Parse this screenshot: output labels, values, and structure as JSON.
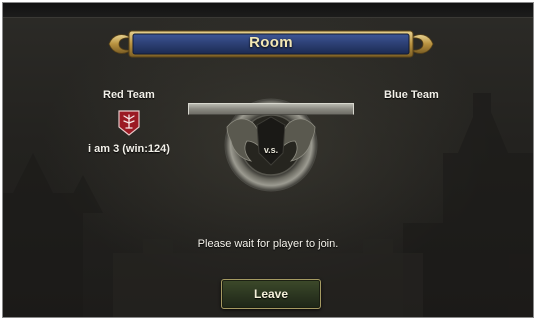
{
  "room": {
    "title": "Room"
  },
  "red_team": {
    "label": "Red Team",
    "player": "i am 3 (win:124)",
    "emblem_icon": "flame-crest-icon",
    "color": "#9b1a24"
  },
  "blue_team": {
    "label": "Blue Team"
  },
  "versus": {
    "label": "v.s."
  },
  "status": {
    "message": "Please wait for player to join."
  },
  "actions": {
    "leave_label": "Leave"
  },
  "colors": {
    "banner_fill": "#2c3f73",
    "banner_gold": "#c9a95a",
    "title_text": "#f2e7b4",
    "button_fill": "#2b3520"
  }
}
